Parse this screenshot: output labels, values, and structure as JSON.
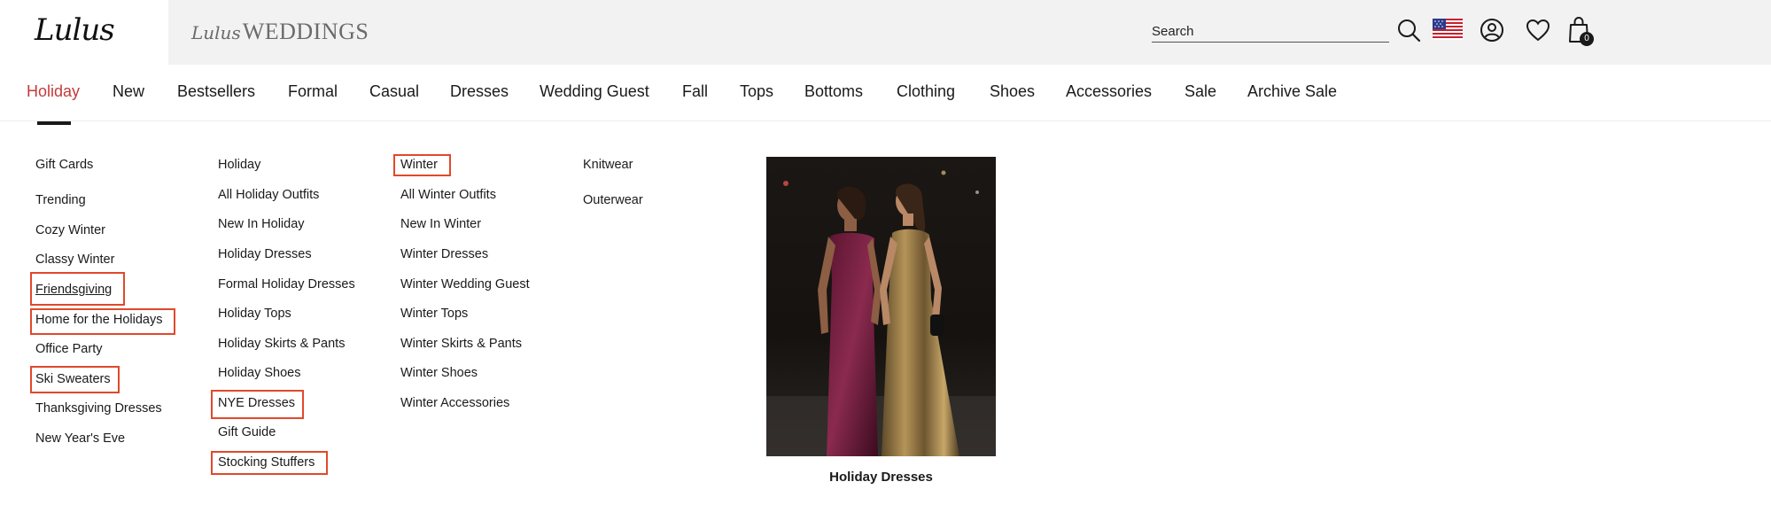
{
  "header": {
    "logo": "Lulus",
    "weddings_script": "Lulus",
    "weddings_word": "WEDDINGS",
    "search_placeholder": "Search",
    "cart_count": "0",
    "icons": [
      "search-icon",
      "us-flag-icon",
      "account-icon",
      "heart-icon",
      "bag-icon"
    ]
  },
  "nav": {
    "items": [
      "Holiday",
      "New",
      "Bestsellers",
      "Formal",
      "Casual",
      "Dresses",
      "Wedding Guest",
      "Fall",
      "Tops",
      "Bottoms",
      "Clothing",
      "Shoes",
      "Accessories",
      "Sale",
      "Archive Sale"
    ],
    "active": "Holiday"
  },
  "menu": {
    "col1": [
      "Gift Cards",
      "Trending",
      "Cozy Winter",
      "Classy Winter",
      "Friendsgiving",
      "Home for the Holidays",
      "Office Party",
      "Ski Sweaters",
      "Thanksgiving Dresses",
      "New Year's Eve"
    ],
    "col2": [
      "Holiday",
      "All Holiday Outfits",
      "New In Holiday",
      "Holiday Dresses",
      "Formal Holiday Dresses",
      "Holiday Tops",
      "Holiday Skirts & Pants",
      "Holiday Shoes",
      "NYE Dresses",
      "Gift Guide",
      "Stocking Stuffers"
    ],
    "col3": [
      "Winter",
      "All Winter Outfits",
      "New In Winter",
      "Winter Dresses",
      "Winter Wedding Guest",
      "Winter Tops",
      "Winter Skirts & Pants",
      "Winter Shoes",
      "Winter Accessories"
    ],
    "col4": [
      "Knitwear",
      "Outerwear"
    ],
    "highlighted": [
      "Friendsgiving",
      "Home for the Holidays",
      "Ski Sweaters",
      "NYE Dresses",
      "Stocking Stuffers",
      "Winter"
    ]
  },
  "promo": {
    "caption": "Holiday Dresses"
  },
  "colors": {
    "active_nav": "#c23b3b",
    "highlight_box": "#e0492b",
    "header_gray": "#f2f2f2"
  }
}
